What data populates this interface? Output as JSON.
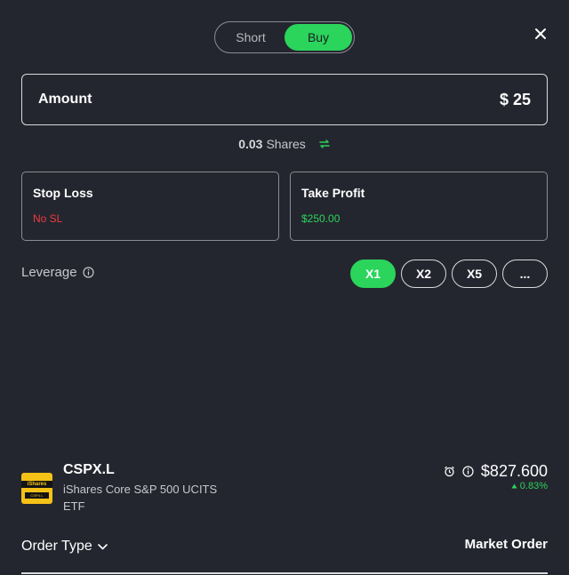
{
  "toggle": {
    "short_label": "Short",
    "buy_label": "Buy",
    "selected": "Buy"
  },
  "amount": {
    "label": "Amount",
    "value": "$ 25"
  },
  "shares": {
    "count": "0.03",
    "unit": "Shares"
  },
  "stop_loss": {
    "title": "Stop Loss",
    "value": "No SL"
  },
  "take_profit": {
    "title": "Take Profit",
    "value": "$250.00"
  },
  "leverage": {
    "label": "Leverage",
    "options": [
      "X1",
      "X2",
      "X5",
      "..."
    ],
    "selected": "X1"
  },
  "asset": {
    "logo_brand": "iShares",
    "logo_ticker": "CSPX.L",
    "symbol": "CSPX.L",
    "name": "iShares Core S&P 500 UCITS ETF",
    "price": "$827.600",
    "change": "0.83%"
  },
  "order": {
    "type_label": "Order Type",
    "type_value": "Market Order"
  },
  "colors": {
    "accent": "#2bd45b",
    "negative": "#f0393f",
    "background": "#24262f"
  },
  "icons": [
    "close-icon",
    "swap-icon",
    "info-icon",
    "alarm-icon",
    "chevron-down-icon",
    "caret-up-icon"
  ]
}
